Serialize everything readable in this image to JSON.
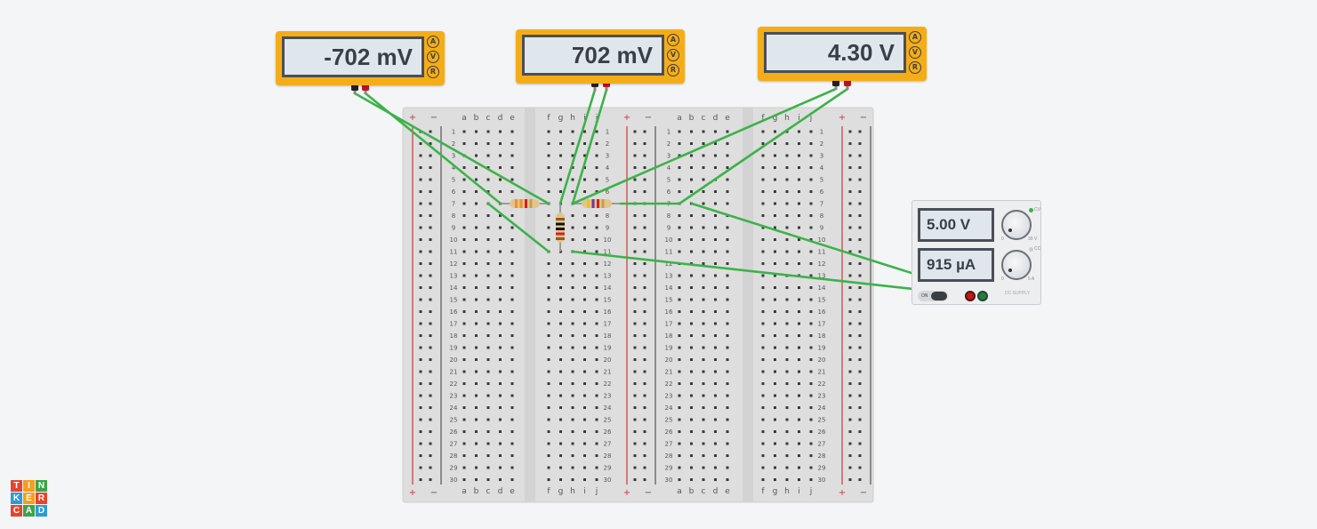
{
  "meters": [
    {
      "id": "meter-1",
      "reading": "-702 mV",
      "modes": [
        "A",
        "V",
        "R"
      ]
    },
    {
      "id": "meter-2",
      "reading": "702 mV",
      "modes": [
        "A",
        "V",
        "R"
      ]
    },
    {
      "id": "meter-3",
      "reading": "4.30 V",
      "modes": [
        "A",
        "V",
        "R"
      ]
    }
  ],
  "power_supply": {
    "voltage": "5.00 V",
    "current": "915 µA",
    "switch_label": "ON",
    "cv_label": "CV",
    "cc_label": "CC",
    "v_min": "0",
    "v_max": "30 V",
    "a_min": "0",
    "a_max": "5 A",
    "brand": "DC SUPPLY"
  },
  "breadboard": {
    "left_cols": [
      "a",
      "b",
      "c",
      "d",
      "e"
    ],
    "right_cols": [
      "f",
      "g",
      "h",
      "i",
      "j"
    ],
    "rows": 30,
    "rail_plus": "+",
    "rail_minus": "−"
  },
  "logo": {
    "letters": [
      "T",
      "I",
      "N",
      "K",
      "E",
      "R",
      "C",
      "A",
      "D"
    ]
  },
  "colors": {
    "wire": "#3cb24a",
    "meter": "#f5ad17",
    "logo": [
      "#e5452f",
      "#f59f1c",
      "#3aa44a",
      "#2d9ad6",
      "#f59f1c",
      "#e5452f",
      "#e5452f",
      "#3aa44a",
      "#2d9ad6"
    ]
  }
}
